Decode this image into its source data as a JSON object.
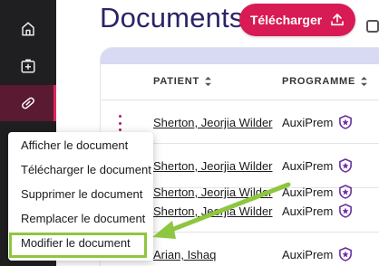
{
  "header": {
    "title": "Documents",
    "upload_label": "Télécharger"
  },
  "sidebar": {
    "items": [
      {
        "icon": "home-icon"
      },
      {
        "icon": "medical-folder-icon"
      },
      {
        "icon": "pill-icon",
        "active": true
      }
    ]
  },
  "table": {
    "columns": [
      "PATIENT",
      "PROGRAMME"
    ],
    "rows": [
      {
        "patient": "Sherton, Jeorjia Wilder",
        "programme": "AuxiPrem"
      },
      {
        "patient": "Sherton, Jeorjia Wilder",
        "programme": "AuxiPrem"
      },
      {
        "patient": "Sherton, Jeorjia Wilder",
        "programme": "AuxiPrem"
      },
      {
        "patient": "Sherton, Jeorjia Wilder",
        "programme": "AuxiPrem"
      },
      {
        "patient": "Arian, Ishaq",
        "programme": "AuxiPrem"
      }
    ]
  },
  "context_menu": {
    "items": [
      "Afficher le document",
      "Télécharger le document",
      "Supprimer le document",
      "Remplacer le document",
      "Modifier le document"
    ],
    "highlighted_index": 4
  },
  "colors": {
    "sidebar_bg": "#1f1f22",
    "accent": "#d81b54",
    "title": "#2a2466",
    "shield": "#6b2fa0",
    "annotation": "#8dc63f"
  }
}
